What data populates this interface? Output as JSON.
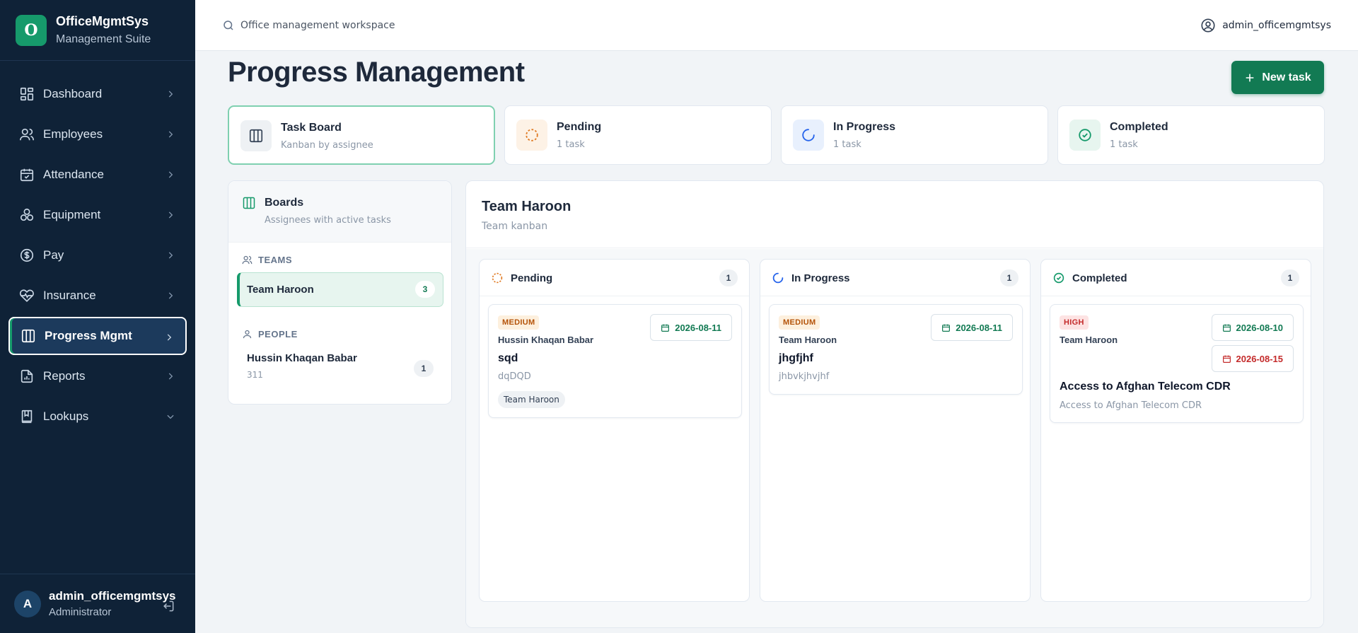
{
  "brand": {
    "logo_letter": "O",
    "name": "OfficeMgmtSys",
    "subtitle": "Management Suite",
    "accent": "#169a6b"
  },
  "sidebar": {
    "items": [
      {
        "label": "Dashboard",
        "icon": "dashboard-icon"
      },
      {
        "label": "Employees",
        "icon": "users-icon"
      },
      {
        "label": "Attendance",
        "icon": "calendar-check-icon"
      },
      {
        "label": "Equipment",
        "icon": "equipment-icon"
      },
      {
        "label": "Pay",
        "icon": "pay-icon"
      },
      {
        "label": "Insurance",
        "icon": "heart-pulse-icon"
      },
      {
        "label": "Progress Mgmt",
        "icon": "columns-icon",
        "active": true
      },
      {
        "label": "Reports",
        "icon": "report-icon"
      },
      {
        "label": "Lookups",
        "icon": "book-icon",
        "chevron": "down"
      }
    ],
    "footer": {
      "avatar_letter": "A",
      "username": "admin_officemgmtsys",
      "role": "Administrator"
    }
  },
  "topbar": {
    "search_placeholder": "Office management workspace",
    "username": "admin_officemgmtsys"
  },
  "page": {
    "title": "Progress Management",
    "new_task_label": "New task"
  },
  "stats": [
    {
      "title": "Task Board",
      "subtitle": "Kanban by assignee",
      "icon": "columns-icon",
      "active": true
    },
    {
      "title": "Pending",
      "subtitle": "1 task",
      "icon": "dashed-circle-icon",
      "color": "#e07b24"
    },
    {
      "title": "In Progress",
      "subtitle": "1 task",
      "icon": "spinner-icon",
      "color": "#2563eb"
    },
    {
      "title": "Completed",
      "subtitle": "1 task",
      "icon": "check-circle-icon",
      "color": "#169a6b"
    }
  ],
  "boards": {
    "title": "Boards",
    "subtitle": "Assignees with active tasks",
    "teams_label": "TEAMS",
    "teams": [
      {
        "name": "Team Haroon",
        "count": "3"
      }
    ],
    "people_label": "PEOPLE",
    "people": [
      {
        "name": "Hussin Khaqan Babar",
        "sub": "311",
        "count": "1"
      }
    ]
  },
  "team_panel": {
    "title": "Team Haroon",
    "subtitle": "Team kanban",
    "columns": [
      {
        "title": "Pending",
        "count": "1",
        "color": "#e07b24",
        "card": {
          "priority": "MEDIUM",
          "assignee": "Hussin Khaqan Babar",
          "dates": [
            "2026-08-11"
          ],
          "title": "sqd",
          "description": "dqDQD",
          "tag": "Team Haroon"
        }
      },
      {
        "title": "In Progress",
        "count": "1",
        "color": "#2563eb",
        "card": {
          "priority": "MEDIUM",
          "assignee": "Team Haroon",
          "dates": [
            "2026-08-11"
          ],
          "title": "jhgfjhf",
          "description": "jhbvkjhvjhf"
        }
      },
      {
        "title": "Completed",
        "count": "1",
        "color": "#169a6b",
        "card": {
          "priority": "HIGH",
          "assignee": "Team Haroon",
          "dates": [
            "2026-08-10",
            "2026-08-15"
          ],
          "title": "Access to Afghan Telecom CDR",
          "description": "Access to Afghan Telecom CDR"
        }
      }
    ]
  }
}
